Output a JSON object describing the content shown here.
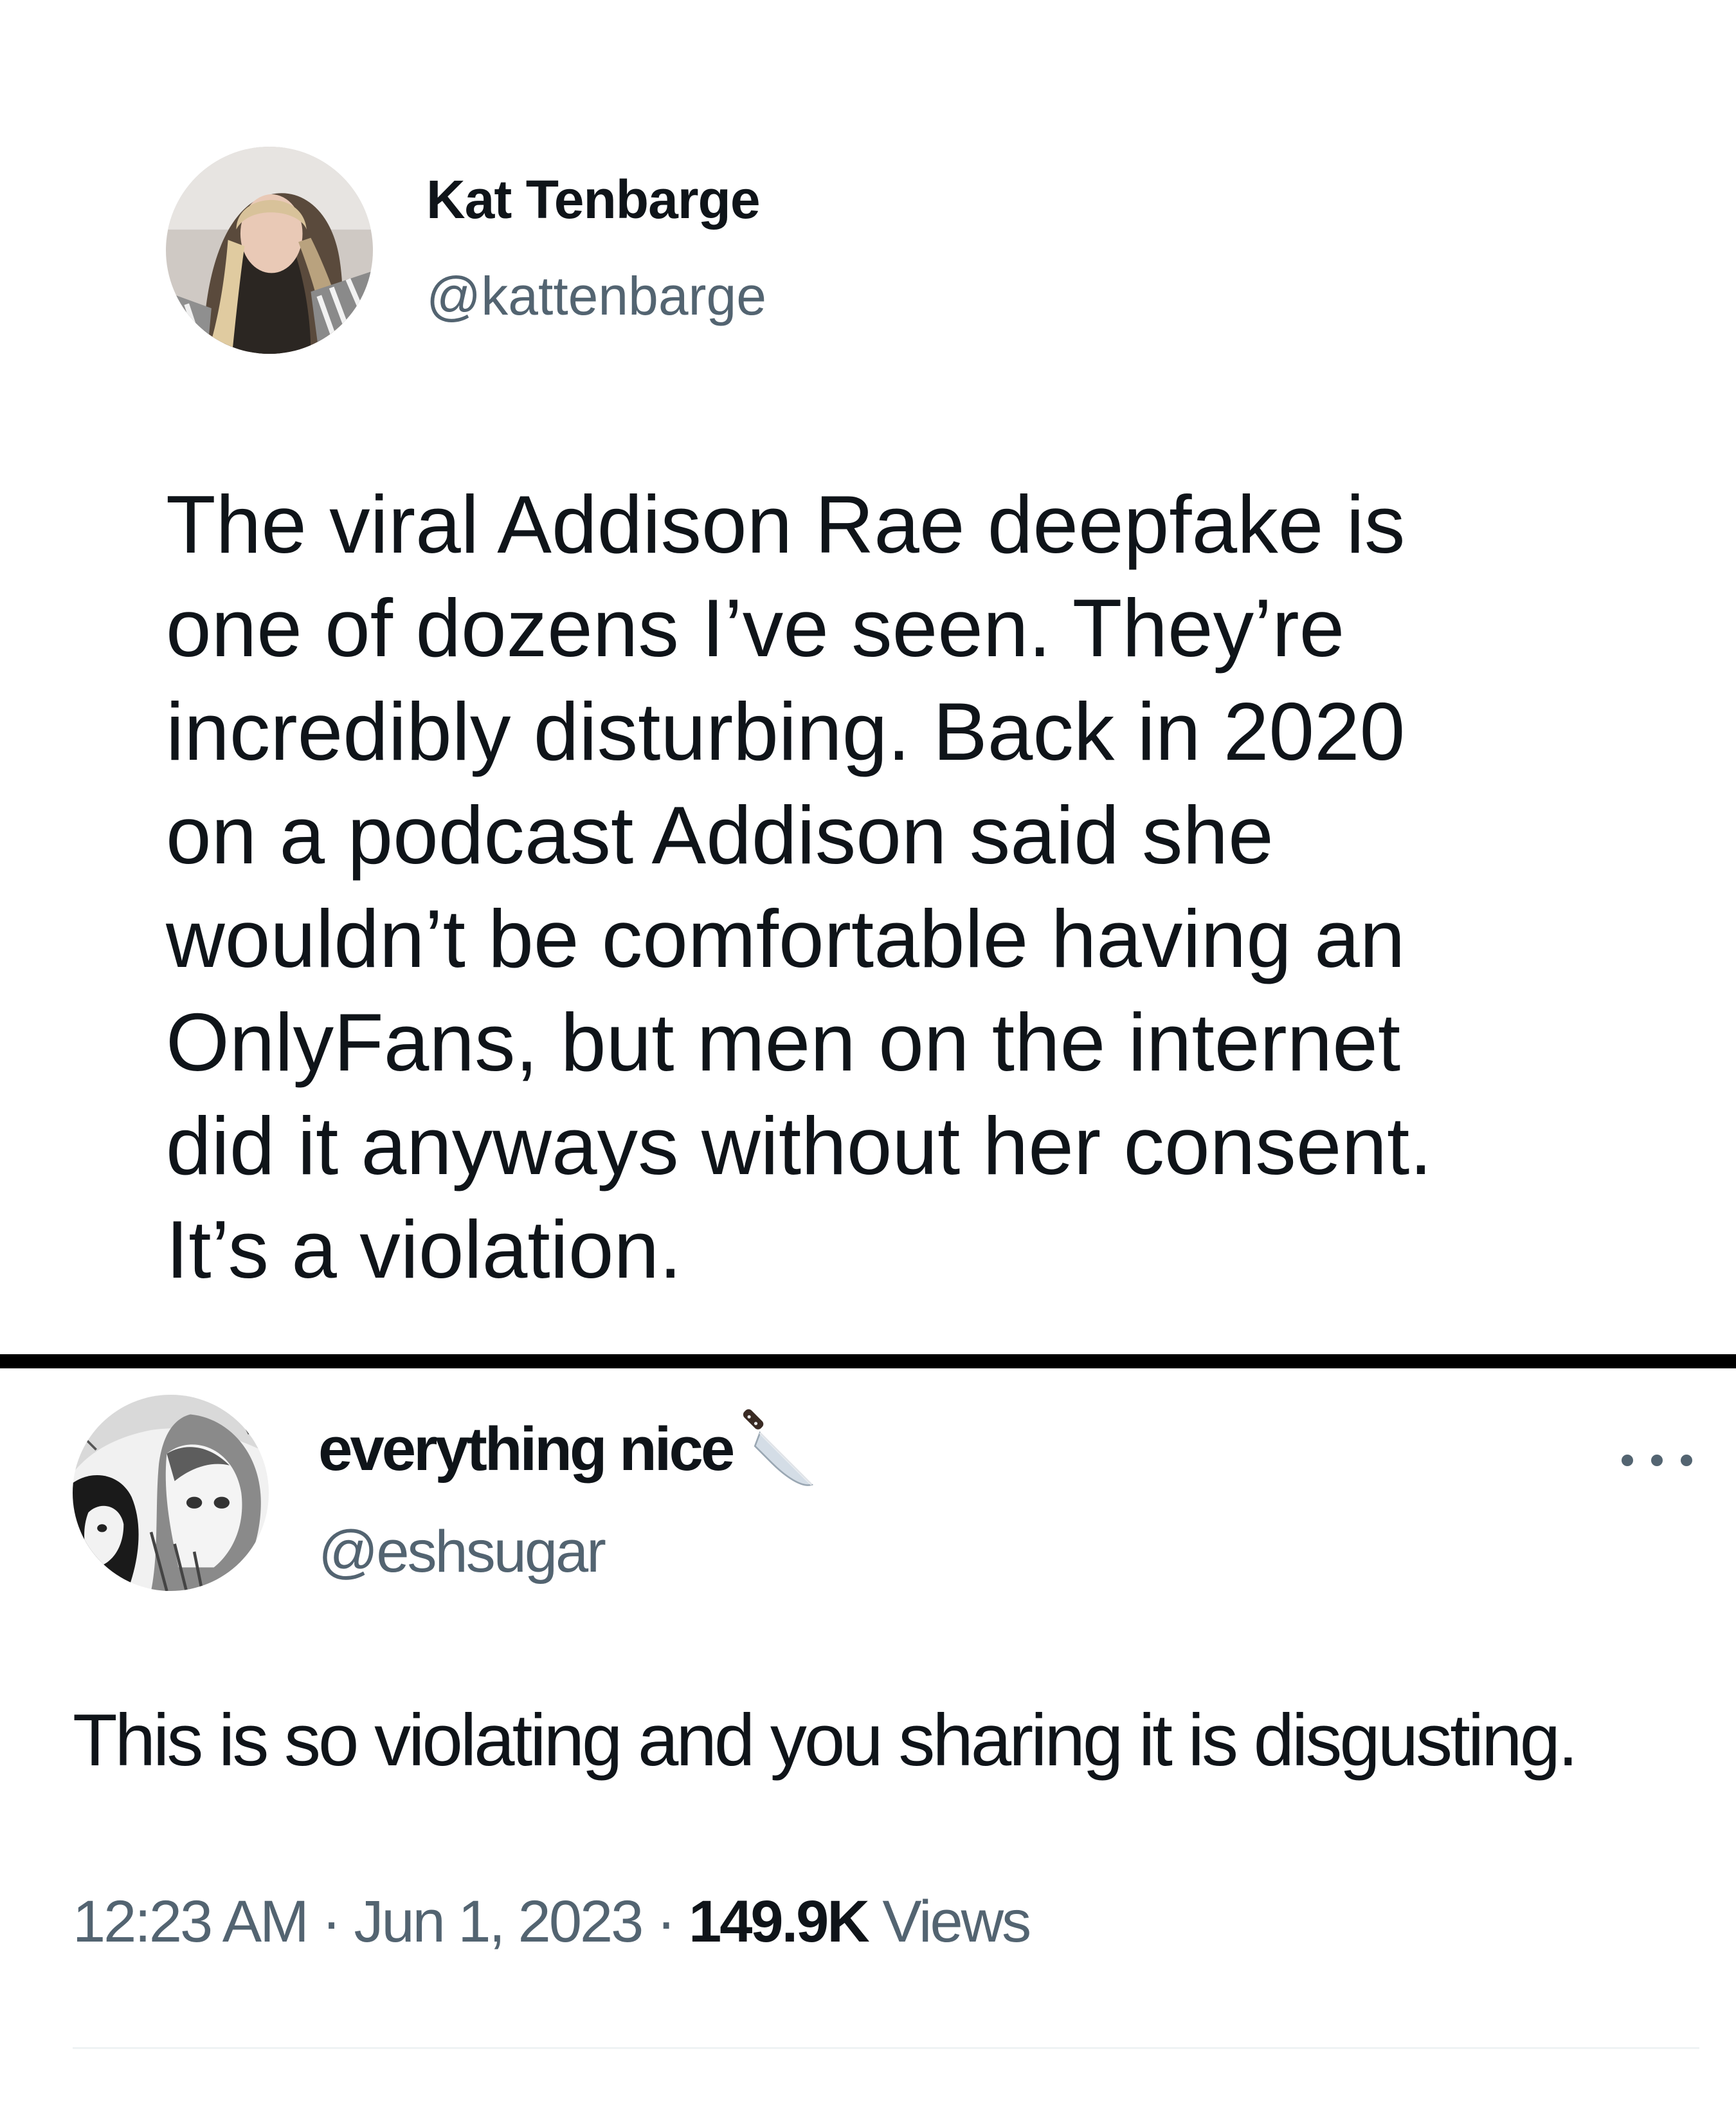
{
  "tweet_top": {
    "author_name": "Kat Tenbarge",
    "author_handle": "@kattenbarge",
    "body_lines": [
      "The viral Addison Rae deepfake is",
      "one of dozens I’ve seen. They’re",
      "incredibly disturbing. Back in 2020",
      "on a podcast Addison said she",
      "wouldn’t be comfortable having an",
      "OnlyFans, but men on the internet",
      "did it anyways without her consent.",
      "It’s a violation."
    ]
  },
  "tweet_bottom": {
    "author_name": "everything nice",
    "name_emoji_icon": "kitchen-knife-icon",
    "author_handle": "@eshsugar",
    "more_icon": "more-options-icon",
    "body": "This is so violating and you sharing it is disgusting.",
    "time": "12:23 AM",
    "separator": " · ",
    "date": "Jun 1, 2023",
    "views_count": "149.9K",
    "views_label": " Views"
  },
  "colors": {
    "text_primary": "#0f1419",
    "text_secondary": "#536471",
    "divider": "#000000"
  }
}
